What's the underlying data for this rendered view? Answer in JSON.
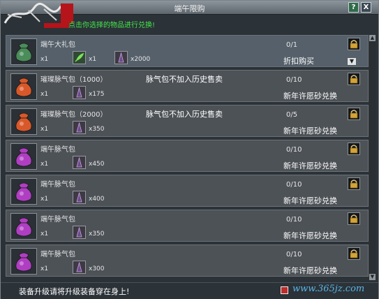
{
  "window": {
    "title": "端午限购",
    "help_label": "?",
    "close_label": "X"
  },
  "hint": "点击你选择的物品进行兑换!",
  "items": [
    {
      "name": "端午大礼包",
      "qty": "x1",
      "note": "",
      "cost1": "x1",
      "cost2": "x2000",
      "limit": "0/1",
      "button": "折扣购买",
      "icon_color": "green"
    },
    {
      "name": "璀璨脉气包（1000）",
      "qty": "x1",
      "note": "脉气包不加入历史售卖",
      "cost2": "x175",
      "limit": "0/10",
      "button": "新年许愿砂兑换",
      "icon_color": "orange"
    },
    {
      "name": "璀璨脉气包（2000）",
      "qty": "x1",
      "note": "脉气包不加入历史售卖",
      "cost2": "x350",
      "limit": "0/5",
      "button": "新年许愿砂兑换",
      "icon_color": "orange"
    },
    {
      "name": "端午脉气包",
      "qty": "x1",
      "note": "",
      "cost2": "x450",
      "limit": "0/10",
      "button": "新年许愿砂兑换",
      "icon_color": "purple"
    },
    {
      "name": "端午脉气包",
      "qty": "x1",
      "note": "",
      "cost2": "x400",
      "limit": "0/10",
      "button": "新年许愿砂兑换",
      "icon_color": "purple"
    },
    {
      "name": "端午脉气包",
      "qty": "x1",
      "note": "",
      "cost2": "x350",
      "limit": "0/10",
      "button": "新年许愿砂兑换",
      "icon_color": "purple"
    },
    {
      "name": "端午脉气包",
      "qty": "x1",
      "note": "",
      "cost2": "x300",
      "limit": "0/10",
      "button": "新年许愿砂兑换",
      "icon_color": "purple"
    }
  ],
  "footer": {
    "text": "装备升级请将升级装备穿在身上!",
    "watermark": "www.365jz.com"
  },
  "colors": {
    "hint": "#46e64a",
    "green_bag": "#4a8c5a",
    "orange_bag": "#d9582a",
    "purple_bag": "#b03ec2"
  }
}
